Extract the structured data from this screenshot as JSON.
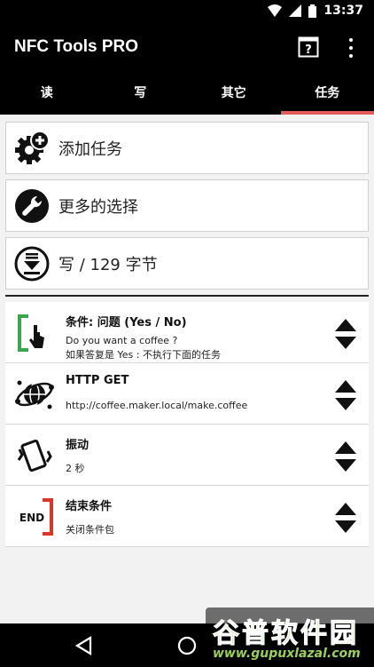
{
  "status": {
    "time": "13:37"
  },
  "app": {
    "title": "NFC Tools PRO"
  },
  "tabs": [
    {
      "label": "读"
    },
    {
      "label": "写"
    },
    {
      "label": "其它"
    },
    {
      "label": "任务",
      "active": true
    }
  ],
  "actions": [
    {
      "label": "添加任务",
      "icon": "add-task-gear-icon"
    },
    {
      "label": "更多的选择",
      "icon": "wrench-icon"
    },
    {
      "label": "写 / 129 字节",
      "icon": "write-download-icon"
    }
  ],
  "tasks": [
    {
      "title": "条件: 问题 (Yes / No)",
      "lines": [
        "Do you want a coffee ?",
        "如果答复是 Yes : 不执行下面的任务"
      ],
      "icon": "condition-touch-icon"
    },
    {
      "title": "HTTP GET",
      "lines": [
        "http://coffee.maker.local/make.coffee"
      ],
      "icon": "globe-network-icon"
    },
    {
      "title": "振动",
      "lines": [
        "2 秒"
      ],
      "icon": "vibrate-icon"
    },
    {
      "title": "结束条件",
      "lines": [
        "关闭条件包"
      ],
      "icon": "end-condition-icon",
      "badge": "END"
    }
  ],
  "watermark": {
    "brand": "谷普软件园",
    "url": "www.gupuxlazal.com"
  },
  "colors": {
    "tab_indicator": "#e25a5a",
    "condition_green": "#3aa84a",
    "end_red": "#d9362b"
  }
}
